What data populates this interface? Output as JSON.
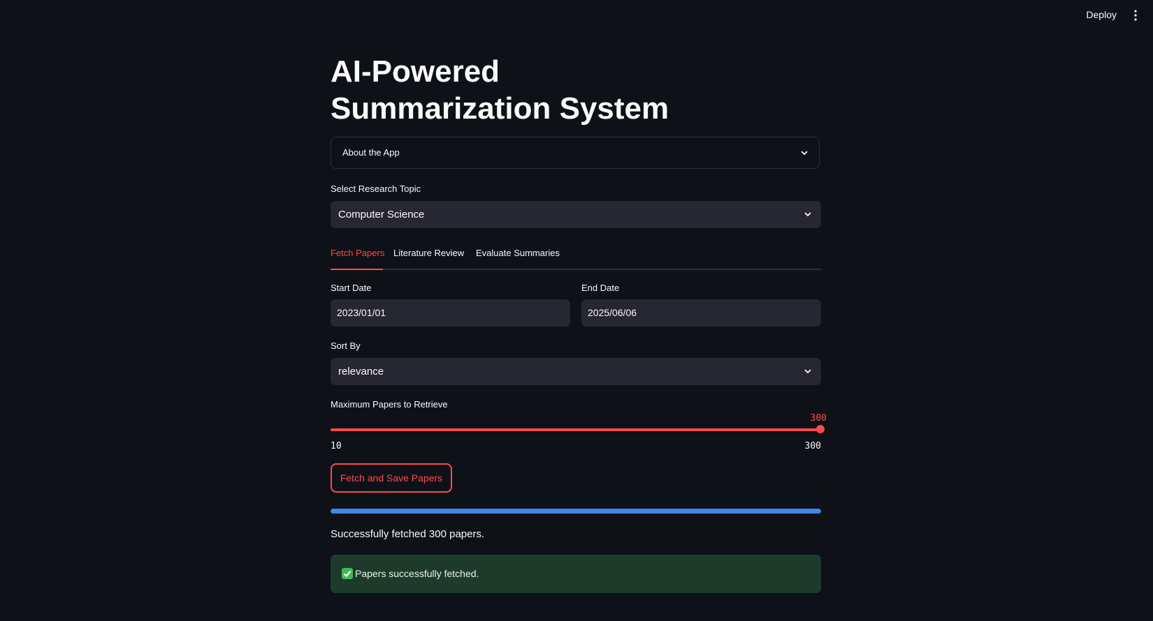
{
  "header": {
    "deploy_label": "Deploy"
  },
  "page": {
    "title": "AI-Powered Summarization System"
  },
  "expander": {
    "label": "About the App"
  },
  "topic": {
    "label": "Select Research Topic",
    "value": "Computer Science"
  },
  "tabs": [
    {
      "label": "Fetch Papers",
      "active": true
    },
    {
      "label": "Literature Review",
      "active": false
    },
    {
      "label": "Evaluate Summaries",
      "active": false
    }
  ],
  "dates": {
    "start_label": "Start Date",
    "start_value": "2023/01/01",
    "end_label": "End Date",
    "end_value": "2025/06/06"
  },
  "sort": {
    "label": "Sort By",
    "value": "relevance"
  },
  "max_papers": {
    "label": "Maximum Papers to Retrieve",
    "value": "300",
    "min": "10",
    "max": "300"
  },
  "fetch_button": {
    "label": "Fetch and Save Papers"
  },
  "progress": {
    "fraction": 1.0
  },
  "status": {
    "message": "Successfully fetched 300 papers."
  },
  "success_alert": {
    "message": "Papers successfully fetched."
  },
  "colors": {
    "accent": "#ff4b4b",
    "progress": "#3f87e8",
    "success_bg": "#1e3a2b"
  }
}
